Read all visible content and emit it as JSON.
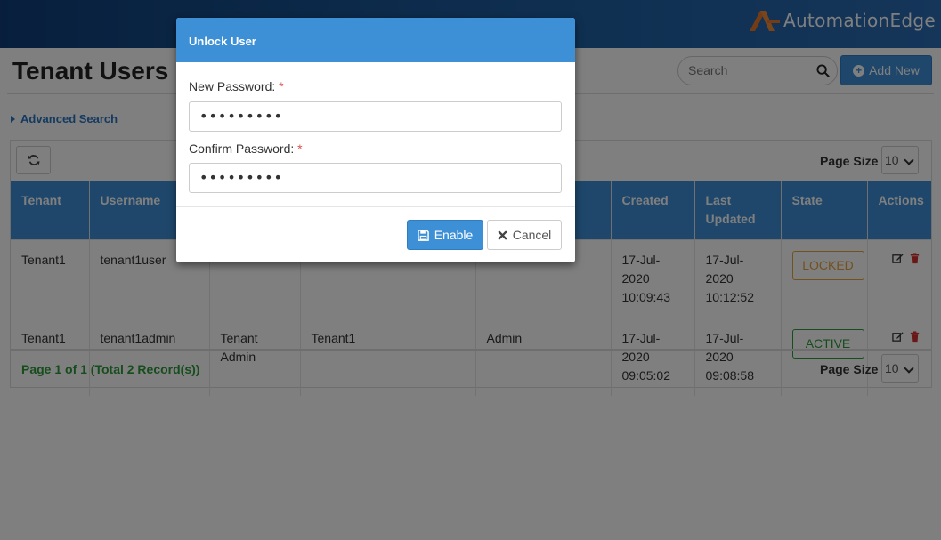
{
  "brand": {
    "name": "AutomationEdge"
  },
  "page": {
    "title": "Tenant Users"
  },
  "search": {
    "placeholder": "Search",
    "value": ""
  },
  "toolbar": {
    "add_new_label": "Add New",
    "advanced_search_label": "Advanced Search"
  },
  "table": {
    "page_size_label": "Page Size",
    "page_size_value": "10",
    "columns": [
      "Tenant",
      "Username",
      "",
      "",
      "",
      "Created",
      "Last Updated",
      "State",
      "Actions"
    ],
    "rows": [
      {
        "tenant": "Tenant1",
        "username": "tenant1user",
        "col3": "",
        "col4": "",
        "col5": "",
        "created": "17-Jul-2020 10:09:43",
        "last_updated": "17-Jul-2020 10:12:52",
        "state": "LOCKED"
      },
      {
        "tenant": "Tenant1",
        "username": "tenant1admin",
        "col3": "Tenant Admin",
        "col4": "Tenant1",
        "col5": "Admin",
        "created": "17-Jul-2020 09:05:02",
        "last_updated": "17-Jul-2020 09:08:58",
        "state": "ACTIVE"
      }
    ],
    "pager_text": "Page 1 of 1 (Total 2 Record(s))"
  },
  "modal": {
    "title": "Unlock User",
    "new_password_label": "New Password:",
    "confirm_password_label": "Confirm Password:",
    "required_mark": "*",
    "new_password_value": "•••••••••",
    "confirm_password_value": "•••••••••",
    "enable_label": "Enable",
    "cancel_label": "Cancel"
  },
  "colors": {
    "primary": "#3d8fd6",
    "locked": "#e6a23c",
    "active": "#2e9a3a",
    "required": "#d9534f",
    "topbar": "#0f3f7a"
  },
  "icons": [
    "brand-logo-icon",
    "search-icon",
    "plus-circle-icon",
    "caret-right-icon",
    "refresh-icon",
    "chevron-down-icon",
    "edit-icon",
    "trash-icon",
    "save-icon",
    "close-icon"
  ]
}
